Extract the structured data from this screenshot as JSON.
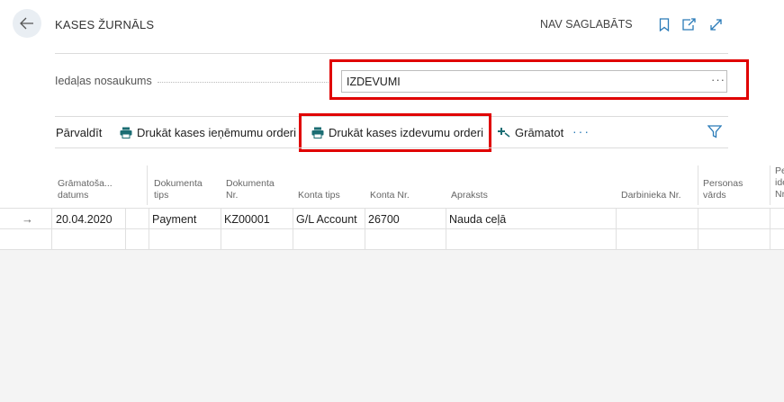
{
  "header": {
    "title": "KASES ŽURNĀLS",
    "status": "NAV SAGLABĀTS",
    "icons": [
      "back-arrow-icon",
      "bookmark-icon",
      "share-icon",
      "expand-icon"
    ]
  },
  "field": {
    "label": "Iedaļas nosaukums",
    "value": "IZDEVUMI",
    "more": "···"
  },
  "actions": {
    "manage": "Pārvaldīt",
    "print_receipt": "Drukāt kases ieņēmumu orderi",
    "print_expense": "Drukāt kases izdevumu orderi",
    "post": "Grāmatot",
    "more": "···"
  },
  "table": {
    "columns": [
      {
        "line1": "Grāmatoša...",
        "line2": "datums"
      },
      {
        "line1": "Dokumenta",
        "line2": "tips"
      },
      {
        "line1": "Dokumenta",
        "line2": "Nr."
      },
      {
        "line1": "",
        "line2": "Konta tips"
      },
      {
        "line1": "",
        "line2": "Konta Nr."
      },
      {
        "line1": "",
        "line2": "Apraksts"
      },
      {
        "line1": "",
        "line2": "Darbinieka Nr."
      },
      {
        "line1": "Personas",
        "line2": "vārds"
      },
      {
        "line1": "Pe",
        "line2": "ide",
        "line3": "Nr"
      }
    ],
    "row": {
      "posting_date": "20.04.2020",
      "document_type": "Payment",
      "document_no": "KZ00001",
      "account_type": "G/L Account",
      "account_no": "26700",
      "description": "Nauda ceļā"
    }
  },
  "colors": {
    "accent": "#2a7bb8",
    "highlight": "#e00000",
    "printer": "#1b6d73"
  }
}
